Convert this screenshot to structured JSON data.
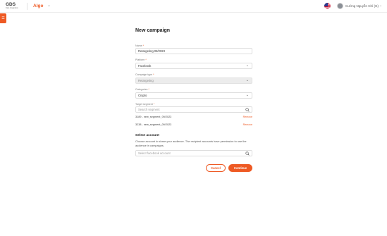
{
  "header": {
    "logo_main": "GDS",
    "logo_sub": "Data Integration",
    "app_name": "Algo",
    "user_name": "Cường Nguyễn Chí (G)",
    "accent_color": "#ee5a24"
  },
  "sidebar": {
    "toggle_icon": "menu-icon"
  },
  "form": {
    "title": "New campaign",
    "name": {
      "label": "Name",
      "required": "*",
      "value": "Retargeting 08/2023"
    },
    "platform": {
      "label": "Platform",
      "required": "*",
      "value": "Facebook"
    },
    "campaign_type": {
      "label": "Campaign type",
      "required": "*",
      "value": "Retargeting"
    },
    "category": {
      "label": "Categories",
      "required": "*",
      "value": "Crypto"
    },
    "target_segment": {
      "label": "Target segment",
      "required": "*",
      "placeholder": "Search segment",
      "items": [
        {
          "text": "3189 - new_segment_09/2023",
          "action": "Remove"
        },
        {
          "text": "3238 - new_segment_09/2023",
          "action": "Remove"
        }
      ]
    },
    "select_account": {
      "title": "Select account",
      "description": "Choose account to share your audience. The recipient accounts have permission to use the audience in campaigns.",
      "placeholder": "Select facebook account"
    },
    "buttons": {
      "cancel": "Cancel",
      "continue": "Continue"
    }
  }
}
